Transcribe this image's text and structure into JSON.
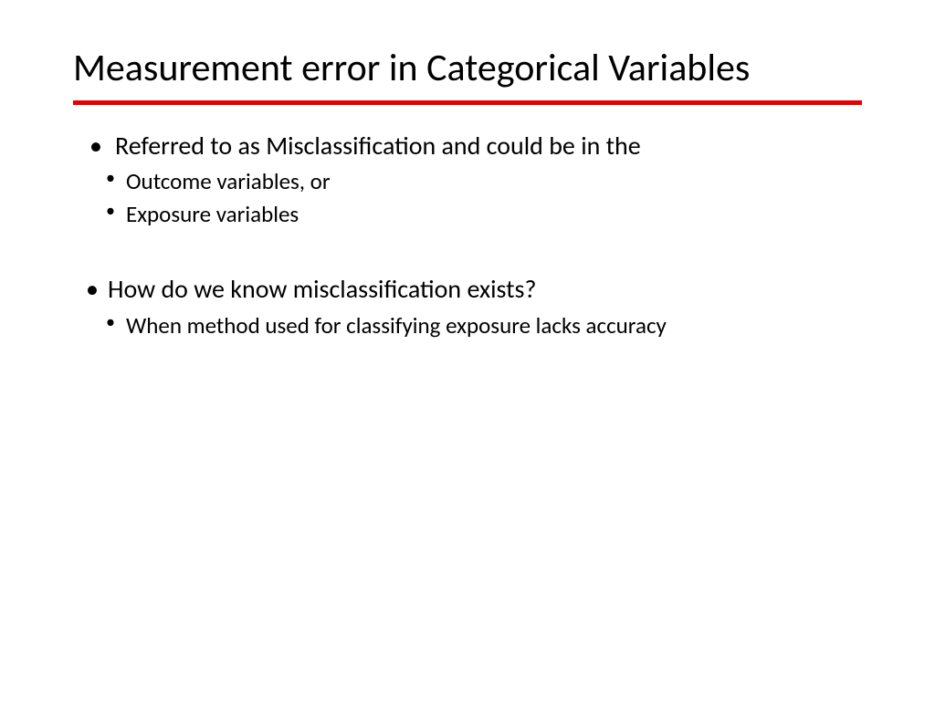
{
  "title": "Measurement error in Categorical Variables",
  "bullets": {
    "b1": "Referred to as Misclassification and could be in the",
    "b1a": "Outcome variables, or",
    "b1b": "Exposure variables",
    "b2": "How do we know misclassification exists?",
    "b2a": "When method used for classifying exposure lacks accuracy"
  }
}
